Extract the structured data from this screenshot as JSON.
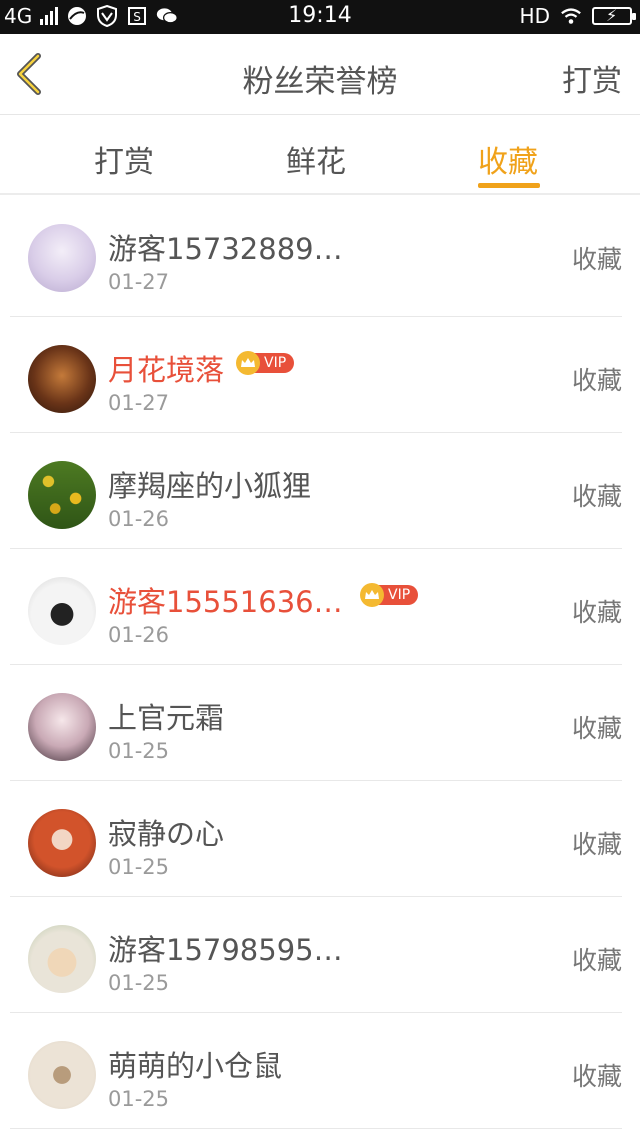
{
  "status_bar": {
    "network": "4G",
    "time": "19:14",
    "hd": "HD"
  },
  "nav": {
    "title": "粉丝荣誉榜",
    "action": "打赏"
  },
  "tabs": [
    {
      "label": "打赏"
    },
    {
      "label": "鲜花"
    },
    {
      "label": "收藏"
    }
  ],
  "list": [
    {
      "name": "游客15732889…",
      "date": "01-27",
      "action": "收藏"
    },
    {
      "name": "月花境落",
      "date": "01-27",
      "action": "收藏",
      "vip_label": "VIP"
    },
    {
      "name": "摩羯座的小狐狸",
      "date": "01-26",
      "action": "收藏"
    },
    {
      "name": "游客15551636…",
      "date": "01-26",
      "action": "收藏",
      "vip_label": "VIP"
    },
    {
      "name": "上官元霜",
      "date": "01-25",
      "action": "收藏"
    },
    {
      "name": "寂静の心",
      "date": "01-25",
      "action": "收藏"
    },
    {
      "name": "游客15798595…",
      "date": "01-25",
      "action": "收藏"
    },
    {
      "name": "萌萌的小仓鼠",
      "date": "01-25",
      "action": "收藏"
    }
  ],
  "colors": {
    "accent": "#f0a21a",
    "vip_red": "#e8503a",
    "status_bar_bg": "#111111"
  },
  "icons": [
    "back-chevron-icon",
    "signal-icon",
    "browser-icon",
    "shield-icon",
    "sim-icon",
    "wechat-icon",
    "wifi-icon",
    "battery-icon",
    "crown-icon"
  ]
}
